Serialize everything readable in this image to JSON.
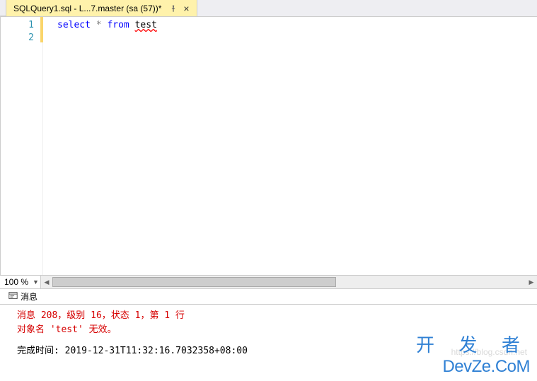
{
  "tab": {
    "title": "SQLQuery1.sql - L...7.master (sa (57))*"
  },
  "editor": {
    "line_numbers": [
      "1",
      "2"
    ],
    "code": {
      "kw_select": "select",
      "star": " * ",
      "kw_from": "from",
      "space": " ",
      "tok_test": "test"
    }
  },
  "zoom": {
    "value": "100 %"
  },
  "messages": {
    "tab_label": "消息",
    "error_line1": "消息 208，级别 16，状态 1，第 1 行",
    "error_line2": "对象名 'test' 无效。",
    "completion": "完成时间: 2019-12-31T11:32:16.7032358+08:00"
  },
  "watermark": {
    "url": "https://blog.csdn.net",
    "cn": "开 发 者",
    "en": "DevZe.CoM"
  }
}
